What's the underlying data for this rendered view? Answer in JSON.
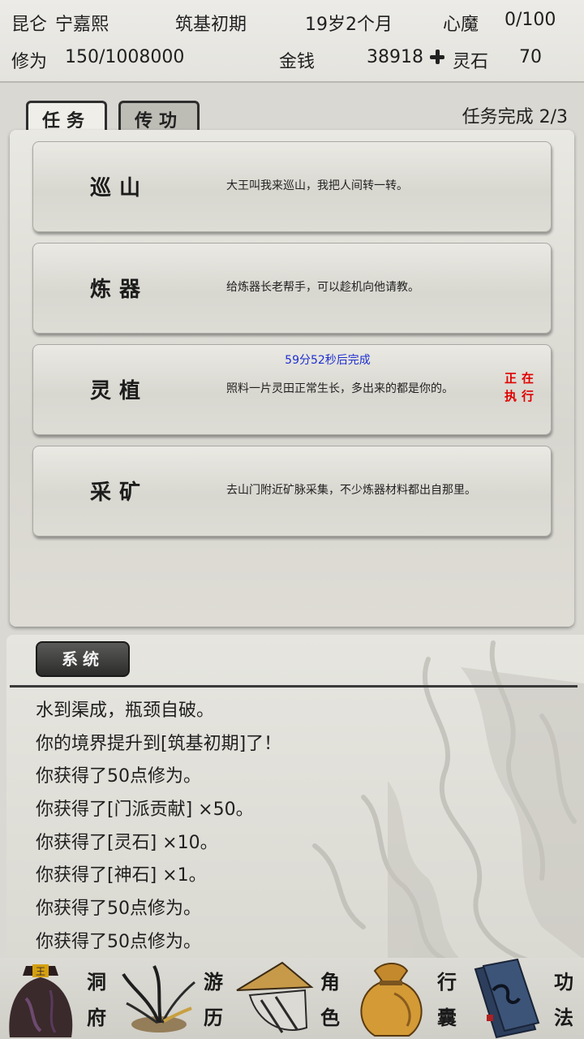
{
  "status": {
    "sect": "昆仑",
    "player_name": "宁嘉熙",
    "realm": "筑基初期",
    "age": "19岁2个月",
    "heart_demon_label": "心魔",
    "heart_demon_value": "0/100",
    "cultivation_label": "修为",
    "cultivation_value": "150/1008000",
    "money_label": "金钱",
    "money_value": "38918",
    "spirit_stone_label": "灵石",
    "spirit_stone_value": "70"
  },
  "tabs": [
    {
      "label": "任务",
      "active": true
    },
    {
      "label": "传功",
      "active": false
    }
  ],
  "task_progress": "任务完成  2/3",
  "tasks": [
    {
      "name": "巡山",
      "desc": "大王叫我来巡山，我把人间转一转。",
      "timer": "",
      "status": ""
    },
    {
      "name": "炼器",
      "desc": "给炼器长老帮手，可以趁机向他请教。",
      "timer": "",
      "status": ""
    },
    {
      "name": "灵植",
      "desc": "照料一片灵田正常生长，多出来的都是你的。",
      "timer": "59分52秒后完成",
      "status_line1": "正在",
      "status_line2": "执行"
    },
    {
      "name": "采矿",
      "desc": "去山门附近矿脉采集，不少炼器材料都出自那里。",
      "timer": "",
      "status": ""
    }
  ],
  "log": {
    "tab_label": "系统",
    "lines": [
      "水到渠成，瓶颈自破。",
      "你的境界提升到[筑基初期]了！",
      "你获得了50点修为。",
      "你获得了[门派贡献] ×50。",
      "你获得了[灵石] ×10。",
      "你获得了[神石] ×1。",
      "你获得了50点修为。",
      "你获得了50点修为。"
    ]
  },
  "nav": [
    {
      "label1": "洞",
      "label2": "府",
      "icon": "cave-dwelling-icon"
    },
    {
      "label1": "游",
      "label2": "历",
      "icon": "travel-hat-icon"
    },
    {
      "label1": "角",
      "label2": "色",
      "icon": "character-icon"
    },
    {
      "label1": "行",
      "label2": "囊",
      "icon": "bag-icon"
    },
    {
      "label1": "功",
      "label2": "法",
      "icon": "scripture-book-icon"
    }
  ],
  "colors": {
    "timer_blue": "#1f2fd0",
    "status_red": "#e00000",
    "log_tab_dark": "#2c2c2b"
  }
}
